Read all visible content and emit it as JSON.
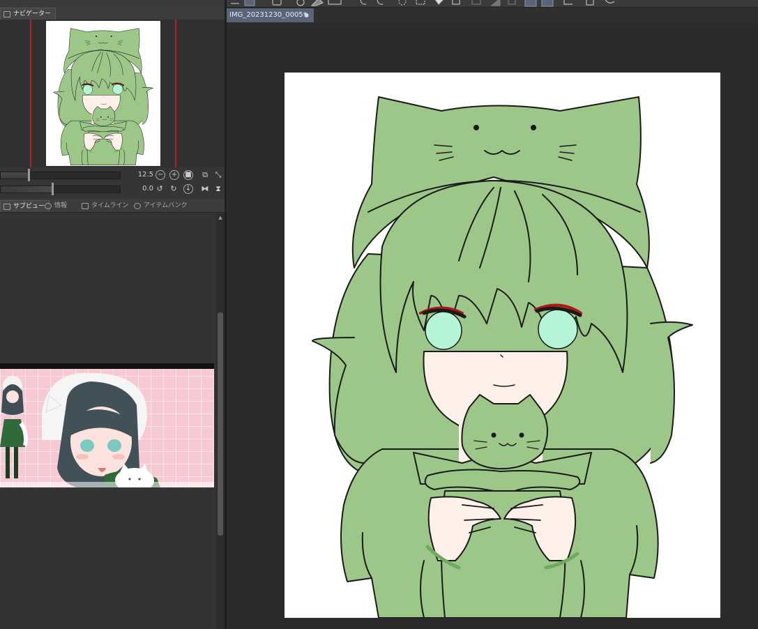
{
  "navigator": {
    "tab_label": "ナビゲーター",
    "zoom_value": "12.5",
    "rotate_value": "0.0"
  },
  "bottom_tabs": {
    "subview": "サブビュー",
    "info": "情報",
    "timeline": "タイムライン",
    "item_bank": "アイテムバンク"
  },
  "document": {
    "tab_title": "IMG_20231230_0005*",
    "close_glyph": "●"
  },
  "colors": {
    "hair_green": "#9dc789",
    "line": "#1a1a1a",
    "skin": "#fff0ea",
    "eye": "#b5f5d6",
    "accent_red": "#b01818",
    "tab_active": "#5a6378"
  }
}
